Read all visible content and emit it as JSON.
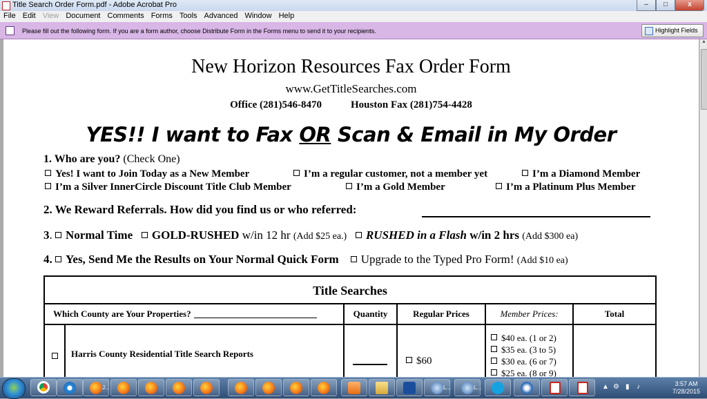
{
  "window": {
    "title": "Title Search Order Form.pdf - Adobe Acrobat Pro",
    "buttons": {
      "minimize": "–",
      "maximize": "□",
      "close": "x"
    }
  },
  "menu": [
    "File",
    "Edit",
    "View",
    "Document",
    "Comments",
    "Forms",
    "Tools",
    "Advanced",
    "Window",
    "Help"
  ],
  "notice": {
    "text": "Please fill out the following form. If you are a form author, choose Distribute Form in the Forms menu to send it to your recipients.",
    "button": "Highlight Fields"
  },
  "form": {
    "title": "New Horizon Resources Fax Order Form",
    "url": "www.GetTitleSearches.com",
    "office": "Office (281)546-8470",
    "fax": "Houston Fax (281)754-4428",
    "banner": {
      "pre": "YES!!  I want to Fax ",
      "or": "OR",
      "post": " Scan & Email in My Order"
    },
    "q1": {
      "label": "1. Who are you?",
      "sub": " (Check One)",
      "options": [
        "Yes! I want to Join Today as a New Member",
        "I’m a regular customer, not a member yet",
        "I’m a Diamond Member",
        "I’m a Silver InnerCircle Discount Title Club Member",
        "I’m a Gold Member",
        "I’m a Platinum Plus Member"
      ]
    },
    "q2": {
      "label": "2. We Reward Referrals.  How did you find us or who referred:"
    },
    "q3": {
      "num": "3",
      "normal": "Normal Time",
      "gold": "GOLD-RUSHED",
      "gold_time": " w/in 12 hr ",
      "gold_price": "(Add $25 ea.)",
      "rush": "RUSHED in a Flash",
      "rush_time": " w/in 2 hrs ",
      "rush_price": "(Add $300 ea)"
    },
    "q4": {
      "label": "4.",
      "normal": "Yes, Send Me the Results on Your Normal Quick Form",
      "upgrade": "Upgrade to the Typed Pro Form!",
      "upgrade_price": "(Add $10 ea)"
    },
    "table": {
      "caption": "Title Searches",
      "headers": {
        "county": "Which County are Your Properties?",
        "quantity": "Quantity",
        "regular": "Regular Prices",
        "member": "Member Prices:",
        "total": "Total"
      },
      "row1": {
        "product": "Harris County Residential Title Search Reports",
        "regular": "$60",
        "member_prices": [
          "$40 ea. (1 or 2)",
          "$35 ea. (3 to 5)",
          "$30 ea. (6 or 7)",
          "$25 ea. (8 or 9)"
        ]
      }
    }
  },
  "taskbar": {
    "tray_time": "3:57 AM",
    "tray_date": "7/28/2015",
    "labels": [
      "J...",
      "L...",
      "L..."
    ]
  }
}
